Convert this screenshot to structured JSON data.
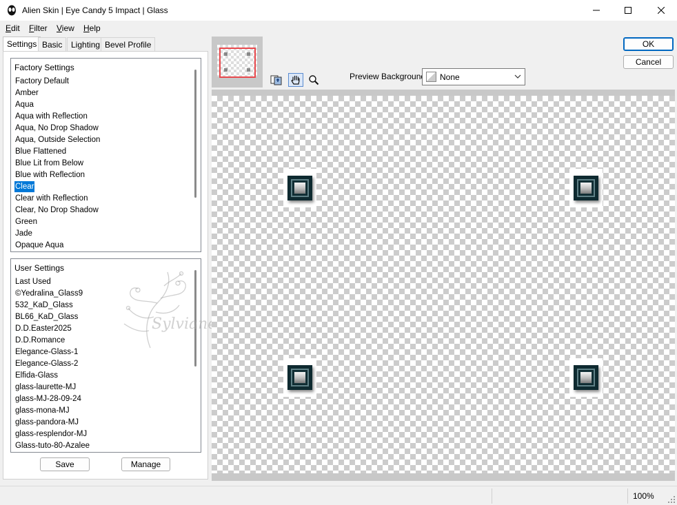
{
  "window": {
    "title": "Alien Skin | Eye Candy 5 Impact | Glass",
    "icon": "alien-skin-icon"
  },
  "menu": {
    "edit": {
      "label_u": "E",
      "label_rest": "dit"
    },
    "filter": {
      "label_u": "F",
      "label_rest": "ilter"
    },
    "view": {
      "label_u": "V",
      "label_rest": "iew"
    },
    "help": {
      "label_u": "H",
      "label_rest": "elp"
    }
  },
  "tabs": [
    "Settings",
    "Basic",
    "Lighting",
    "Bevel Profile"
  ],
  "factory": {
    "header": "Factory Settings",
    "items": [
      "Factory Default",
      "Amber",
      "Aqua",
      "Aqua with Reflection",
      "Aqua, No Drop Shadow",
      "Aqua, Outside Selection",
      "Blue Flattened",
      "Blue Lit from Below",
      "Blue with Reflection",
      "Clear",
      "Clear with Reflection",
      "Clear, No Drop Shadow",
      "Green",
      "Jade",
      "Opaque Aqua"
    ],
    "selected": "Clear"
  },
  "user": {
    "header": "User Settings",
    "items": [
      "Last Used",
      "©Yedralina_Glass9",
      "532_KaD_Glass",
      "BL66_KaD_Glass",
      "D.D.Easter2025",
      "D.D.Romance",
      "Elegance-Glass-1",
      "Elegance-Glass-2",
      "Elfida-Glass",
      "glass-laurette-MJ",
      "glass-MJ-28-09-24",
      "glass-mona-MJ",
      "glass-pandora-MJ",
      "glass-resplendor-MJ",
      "Glass-tuto-80-Azalee"
    ]
  },
  "buttons": {
    "save": "Save",
    "manage": "Manage",
    "ok": "OK",
    "cancel": "Cancel"
  },
  "preview": {
    "label": "Preview Background:",
    "value": "None"
  },
  "watermark": "Sylviane",
  "status": {
    "zoom": "100%"
  },
  "colors": {
    "selection": "#0078d7",
    "nav_rect": "#e8474b",
    "glass_dark": "#0e2a30"
  }
}
